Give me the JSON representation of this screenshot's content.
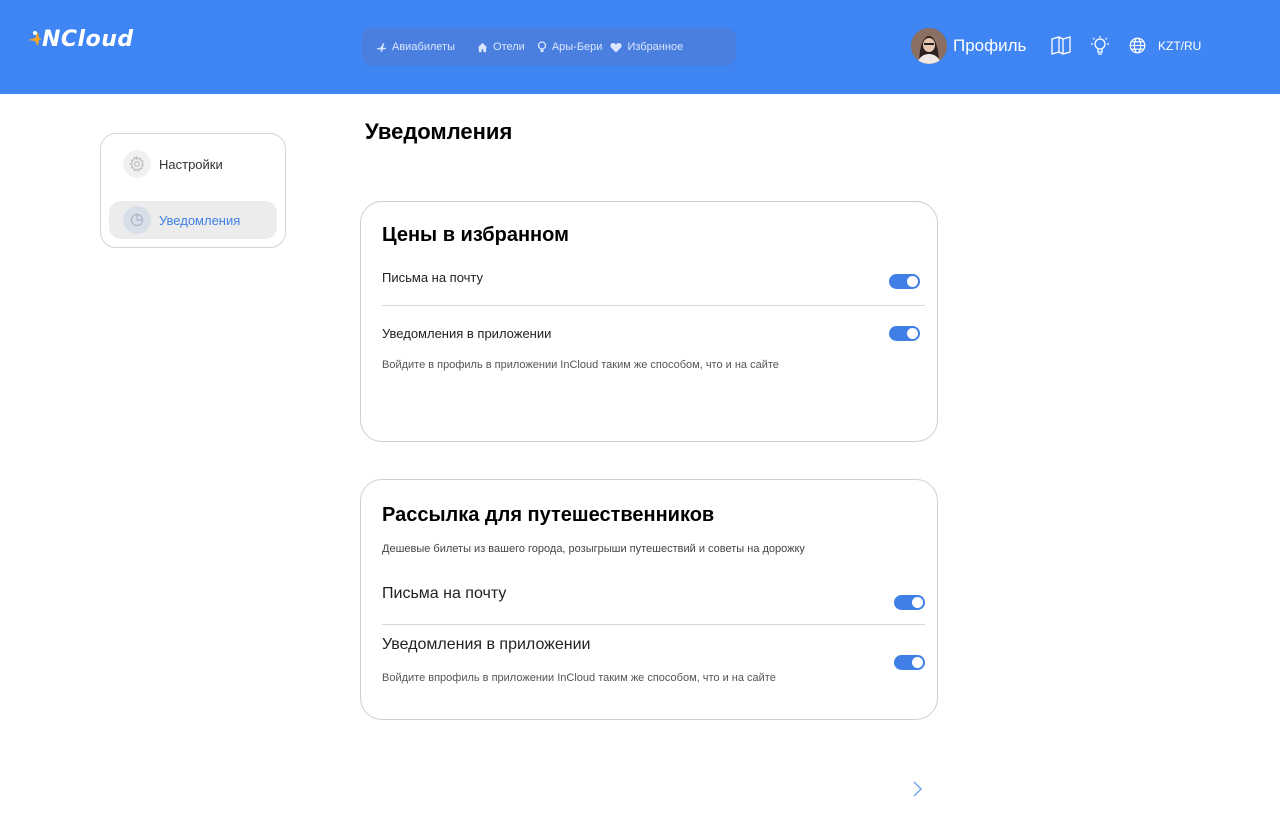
{
  "brand": {
    "name": "NCloud",
    "accent": "#3f86f4",
    "mark_color": "#f5a623"
  },
  "nav": {
    "items": [
      {
        "label": "Авиабилеты",
        "icon": "plane-icon"
      },
      {
        "label": "Отели",
        "icon": "house-icon"
      },
      {
        "label": "Ары-Бери",
        "icon": "bulb-icon"
      },
      {
        "label": "Избранное",
        "icon": "heart-icon"
      }
    ]
  },
  "header": {
    "profile_label": "Профиль",
    "currency_lang": "KZT/RU",
    "icons": [
      "book-icon",
      "lightbulb-icon",
      "globe-icon"
    ]
  },
  "sidebar": {
    "items": [
      {
        "label": "Настройки",
        "icon": "gear-icon",
        "active": false
      },
      {
        "label": "Уведомления",
        "icon": "pie-icon",
        "active": true
      }
    ]
  },
  "page": {
    "title": "Уведомления"
  },
  "cards": [
    {
      "title": "Цены в избранном",
      "rows": [
        {
          "label": "Письма на почту",
          "enabled": true
        },
        {
          "label": "Уведомления в приложении",
          "enabled": true
        }
      ],
      "hint": "Войдите в профиль  в приложении InCloud таким же способом, что и на сайте"
    },
    {
      "title": "Рассылка для путешественников",
      "subtitle": "Дешевые билеты из вашего города, розыгрыши путешествий и советы на дорожку",
      "rows": [
        {
          "label": "Письма на почту",
          "enabled": true
        },
        {
          "label": "Уведомления в приложении",
          "enabled": true
        }
      ],
      "hint": "Войдите впрофиль в приложении  InCloud таким же способом, что и на сайте"
    }
  ],
  "colors": {
    "toggle_on": "#3f7fe6",
    "active_text": "#3f7fe6"
  }
}
